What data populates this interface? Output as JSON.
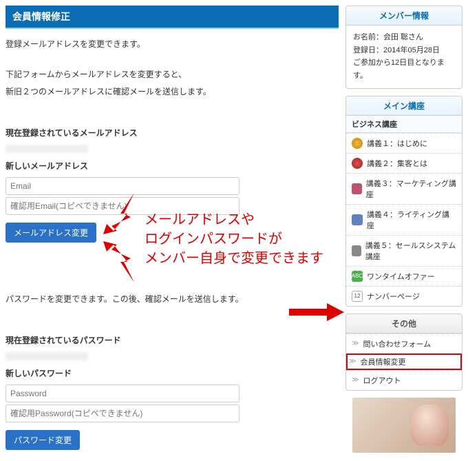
{
  "page": {
    "title": "会員情報修正"
  },
  "email_section": {
    "desc1": "登録メールアドレスを変更できます。",
    "desc2": "下記フォームからメールアドレスを変更すると、",
    "desc3": "新旧２つのメールアドレスに確認メールを送信します。",
    "current_label": "現在登録されているメールアドレス",
    "new_label": "新しいメールアドレス",
    "placeholder_email": "Email",
    "placeholder_email_confirm": "確認用Email(コピペできません)",
    "submit": "メールアドレス変更"
  },
  "password_section": {
    "desc": "パスワードを変更できます。この後、確認メールを送信します。",
    "current_label": "現在登録されているパスワード",
    "new_label": "新しいパスワード",
    "placeholder_pw": "Password",
    "placeholder_pw_confirm": "確認用Password(コピペできません)",
    "submit": "パスワード変更"
  },
  "member_info": {
    "title": "メンバー情報",
    "name": "お名前：会田 聡さん",
    "date": "登録日：2014年05月28日",
    "days": "ご参加から12日目となります。"
  },
  "main_course": {
    "title": "メイン講座",
    "sub": "ビジネス講座",
    "items": [
      "講義１：はじめに",
      "講義２：集客とは",
      "講義３：マーケティング講座",
      "講義４：ライティング講座",
      "講義５：セールスシステム講座",
      "ワンタイムオファー",
      "ナンバーページ"
    ]
  },
  "other": {
    "title": "その他",
    "items": [
      "問い合わせフォーム",
      "会員情報変更",
      "ログアウト"
    ]
  },
  "annotation": {
    "l1": "メールアドレスや",
    "l2": "ログインパスワードが",
    "l3": "メンバー自身で変更できます"
  }
}
